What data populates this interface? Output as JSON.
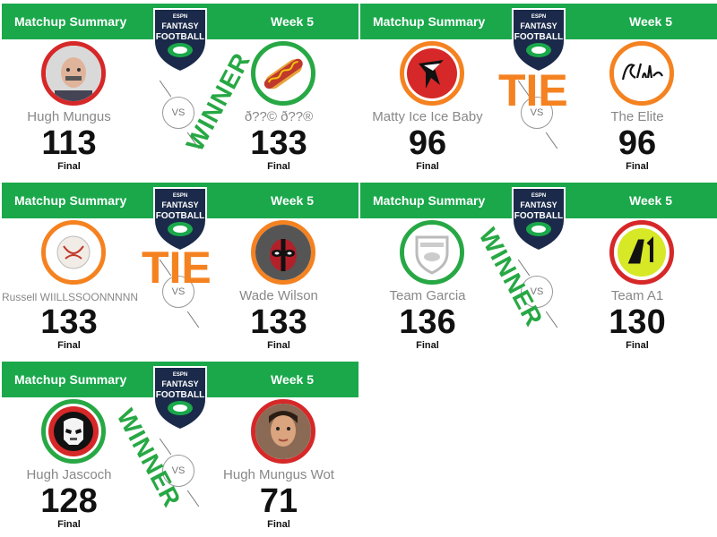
{
  "matchups": [
    {
      "header_left": "Matchup Summary",
      "header_right": "Week 5",
      "vs": "VS",
      "result": "WINNER",
      "left": {
        "name": "Hugh Mungus",
        "score": "113",
        "status": "Final",
        "avatar": "man-face-photo"
      },
      "right": {
        "name": "ð??© ð??®",
        "score": "133",
        "status": "Final",
        "avatar": "hot-dog-icon"
      }
    },
    {
      "header_left": "Matchup Summary",
      "header_right": "Week 5",
      "vs": "VS",
      "result": "TIE",
      "left": {
        "name": "Matty Ice Ice Baby",
        "score": "96",
        "status": "Final",
        "avatar": "falcons-logo"
      },
      "right": {
        "name": "The Elite",
        "score": "96",
        "status": "Final",
        "avatar": "elite-script-logo"
      }
    },
    {
      "header_left": "Matchup Summary",
      "header_right": "Week 5",
      "vs": "VS",
      "result": "TIE",
      "left": {
        "name": "Russell WIILLSSOONNNNN",
        "score": "133",
        "status": "Final",
        "avatar": "volleyball-face-icon"
      },
      "right": {
        "name": "Wade Wilson",
        "score": "133",
        "status": "Final",
        "avatar": "deadpool-photo"
      }
    },
    {
      "header_left": "Matchup Summary",
      "header_right": "Week 5",
      "vs": "VS",
      "result": "WINNER",
      "left": {
        "name": "Team Garcia",
        "score": "136",
        "status": "Final",
        "avatar": "fantasy-football-default-logo"
      },
      "right": {
        "name": "Team A1",
        "score": "130",
        "status": "Final",
        "avatar": "a1-logo"
      }
    },
    {
      "header_left": "Matchup Summary",
      "header_right": "Week 5",
      "vs": "VS",
      "result": "WINNER",
      "left": {
        "name": "Hugh Jascoch",
        "score": "128",
        "status": "Final",
        "avatar": "stormtrooper-icon"
      },
      "right": {
        "name": "Hugh Mungus Wot",
        "score": "71",
        "status": "Final",
        "avatar": "woman-face-photo"
      }
    }
  ],
  "logo": {
    "top_text": "ESPN",
    "line1": "FANTASY",
    "line2": "FOOTBALL"
  },
  "colors": {
    "header": "#1aa84b",
    "winner": "#27a844",
    "loser": "#d62828",
    "tie": "#f58220",
    "logo_navy": "#1b2a4a"
  }
}
